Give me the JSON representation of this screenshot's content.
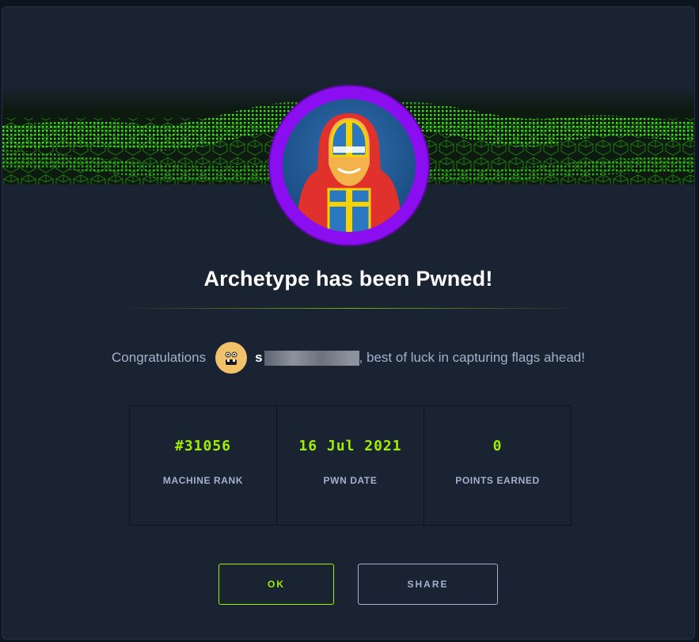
{
  "dialog": {
    "title": "Archetype has been Pwned!",
    "congrats_prefix": "Congratulations",
    "username_visible": "s",
    "congrats_suffix": ", best of luck in capturing flags ahead!"
  },
  "stats": [
    {
      "value": "#31056",
      "label": "MACHINE RANK"
    },
    {
      "value": "16 Jul 2021",
      "label": "PWN DATE"
    },
    {
      "value": "0",
      "label": "POINTS EARNED"
    }
  ],
  "buttons": {
    "ok_label": "OK",
    "share_label": "SHARE"
  },
  "colors": {
    "accent": "#9fef00",
    "background": "#1a2332",
    "avatar_ring": "#8a0ef0",
    "muted_text": "#a4b1cd"
  }
}
